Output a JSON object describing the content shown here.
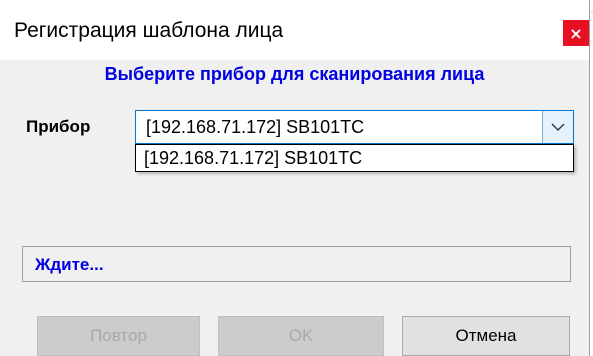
{
  "window": {
    "title": "Регистрация шаблона лица",
    "close_label": "×"
  },
  "main": {
    "heading": "Выберите прибор для сканирования лица",
    "device_label": "Прибор",
    "device_select": {
      "selected": "[192.168.71.172] SB101TC",
      "options": [
        "[192.168.71.172] SB101TC"
      ]
    },
    "status": "Ждите..."
  },
  "buttons": {
    "retry": "Повтор",
    "ok": "OK",
    "cancel": "Отмена"
  },
  "colors": {
    "heading": "#0000e0",
    "status": "#0000e0",
    "close_bg": "#e81123",
    "focus_border": "#0078d7"
  }
}
